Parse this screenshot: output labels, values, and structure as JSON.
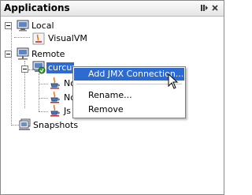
{
  "panel": {
    "title": "Applications",
    "buttons": {
      "minimize": "◂▸",
      "close": "✕"
    }
  },
  "tree": {
    "local": {
      "label": "Local",
      "icon": "computer-icon"
    },
    "visualvm": {
      "label": "VisualVM",
      "icon": "java-app-icon"
    },
    "remote": {
      "label": "Remote",
      "icon": "network-computer-icon"
    },
    "host": {
      "label": "curcum",
      "icon": "remote-host-icon"
    },
    "apps": [
      {
        "label": "No",
        "icon": "java-cup-icon"
      },
      {
        "label": "No",
        "icon": "java-cup-icon"
      },
      {
        "label": "Js",
        "icon": "java-cup-icon"
      }
    ],
    "snapshots": {
      "label": "Snapshots",
      "icon": "snapshots-icon"
    }
  },
  "context_menu": {
    "items": [
      {
        "label": "Add JMX Connection...",
        "highlighted": true
      },
      {
        "label": "Rename...",
        "highlighted": false
      },
      {
        "label": "Remove",
        "highlighted": false
      }
    ]
  },
  "colors": {
    "selection": "#2e6bd0",
    "java_orange": "#e07b20"
  }
}
